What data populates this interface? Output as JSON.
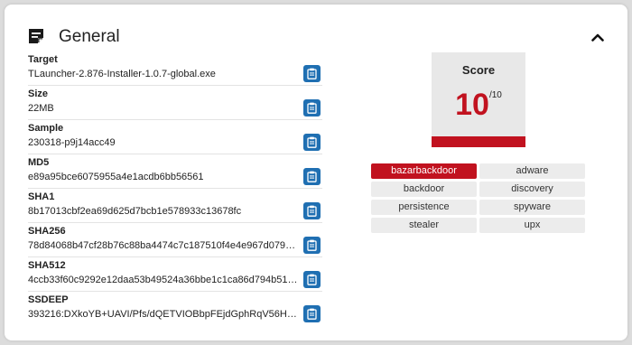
{
  "panel": {
    "title": "General",
    "icon": "notes-icon",
    "collapse_icon": "chevron-up-icon"
  },
  "fields": [
    {
      "label": "Target",
      "value": "TLauncher-2.876-Installer-1.0.7-global.exe"
    },
    {
      "label": "Size",
      "value": "22MB"
    },
    {
      "label": "Sample",
      "value": "230318-p9j14acc49"
    },
    {
      "label": "MD5",
      "value": "e89a95bce6075955a4e1acdb6bb56561"
    },
    {
      "label": "SHA1",
      "value": "8b17013cbf2ea69d625d7bcb1e578933c13678fc"
    },
    {
      "label": "SHA256",
      "value": "78d84068b47cf28b76c88ba4474c7c187510f4e4e967d079d37…"
    },
    {
      "label": "SHA512",
      "value": "4ccb33f60c9292e12daa53b49524a36bbe1c1ca86d794b5134b…"
    },
    {
      "label": "SSDEEP",
      "value": "393216:DXkoYB+UAVI/Pfs/dQETVIOBbpFEjdGphRqV56HpkvQF…"
    }
  ],
  "score": {
    "title": "Score",
    "value": "10",
    "max": "/10",
    "fill_fraction": 1.0,
    "color": "#c1121f"
  },
  "tags": [
    {
      "label": "bazarbackdoor",
      "active": true
    },
    {
      "label": "adware",
      "active": false
    },
    {
      "label": "backdoor",
      "active": false
    },
    {
      "label": "discovery",
      "active": false
    },
    {
      "label": "persistence",
      "active": false
    },
    {
      "label": "spyware",
      "active": false
    },
    {
      "label": "stealer",
      "active": false
    },
    {
      "label": "upx",
      "active": false
    }
  ],
  "colors": {
    "accent_red": "#c1121f",
    "copy_button": "#1f6fb2",
    "tag_bg": "#ececec"
  }
}
